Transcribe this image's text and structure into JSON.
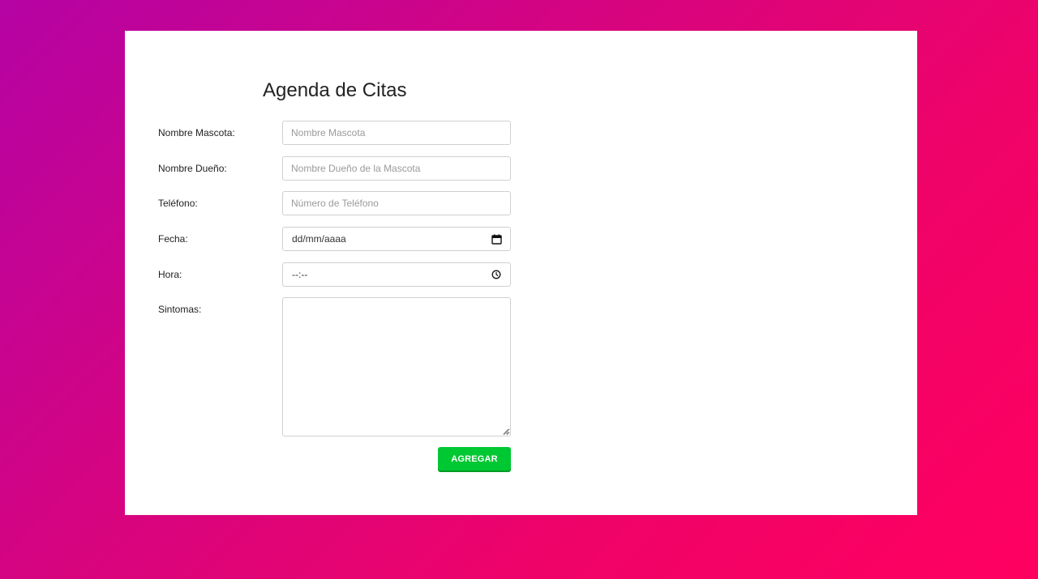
{
  "form": {
    "title": "Agenda de Citas",
    "fields": {
      "mascota": {
        "label": "Nombre Mascota:",
        "placeholder": "Nombre Mascota",
        "value": ""
      },
      "dueno": {
        "label": "Nombre Dueño:",
        "placeholder": "Nombre Dueño de la Mascota",
        "value": ""
      },
      "telefono": {
        "label": "Teléfono:",
        "placeholder": "Número de Teléfono",
        "value": ""
      },
      "fecha": {
        "label": "Fecha:",
        "display": "dd/mm/aaaa",
        "icon": "calendar-icon"
      },
      "hora": {
        "label": "Hora:",
        "display": "--:--",
        "icon": "clock-icon"
      },
      "sintomas": {
        "label": "Sintomas:",
        "value": ""
      }
    },
    "submit_label": "AGREGAR"
  },
  "colors": {
    "gradient_start": "#b503a4",
    "gradient_end": "#ff0060",
    "button": "#00c832",
    "card": "#ffffff"
  }
}
